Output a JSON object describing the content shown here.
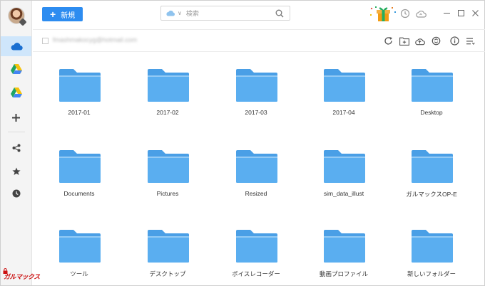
{
  "toolbar": {
    "new_label": "新規"
  },
  "search": {
    "placeholder": "検索"
  },
  "pathbar": {
    "account": "fmashmakocyg@hotmail.com"
  },
  "watermark": {
    "text": "ガルマックス"
  },
  "sidebar": {
    "items": [
      {
        "name": "onedrive",
        "icon": "onedrive-cloud-icon",
        "active": true
      },
      {
        "name": "google-drive-1",
        "icon": "google-drive-icon"
      },
      {
        "name": "google-drive-2",
        "icon": "google-drive-icon"
      },
      {
        "name": "add-account",
        "icon": "plus-icon"
      },
      {
        "name": "share",
        "icon": "share-icon"
      },
      {
        "name": "favorites",
        "icon": "star-icon"
      },
      {
        "name": "recent",
        "icon": "clock-icon"
      }
    ]
  },
  "folders": [
    {
      "name": "2017-01"
    },
    {
      "name": "2017-02"
    },
    {
      "name": "2017-03"
    },
    {
      "name": "2017-04"
    },
    {
      "name": "Desktop"
    },
    {
      "name": "Documents"
    },
    {
      "name": "Pictures"
    },
    {
      "name": "Resized"
    },
    {
      "name": "sim_data_illust"
    },
    {
      "name": "ガルマックスOP-E"
    },
    {
      "name": "ツール"
    },
    {
      "name": "デスクトップ"
    },
    {
      "name": "ボイスレコーダー"
    },
    {
      "name": "動画プロファイル"
    },
    {
      "name": "新しいフォルダー"
    }
  ],
  "colors": {
    "accent": "#2d8cf0",
    "folder": "#5aaef0",
    "folder_tab": "#4a9fe6",
    "sidebar_active": "#cfe6fb"
  }
}
